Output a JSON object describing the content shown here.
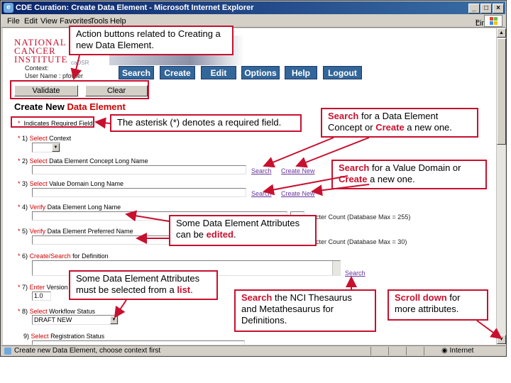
{
  "window": {
    "title": "CDE Curation: Create Data Element - Microsoft Internet Explorer",
    "menu": [
      "File",
      "Edit",
      "View",
      "Favorites",
      "Tools",
      "Help"
    ],
    "links_label": "Links",
    "status_message": "Create new Data Element, choose context first",
    "status_zone": "Internet"
  },
  "header": {
    "logo_line1": "NATIONAL",
    "logo_line2": "CANCER",
    "logo_line3": "INSTITUTE",
    "cadsr": "caDSR",
    "context_label": "Context:",
    "user_label": "User Name : pfowler"
  },
  "nav": [
    "Search",
    "Create",
    "Edit",
    "Options",
    "Help",
    "Logout"
  ],
  "actions": {
    "validate": "Validate",
    "clear": "Clear"
  },
  "page": {
    "title_prefix": "Create New",
    "title_highlight": "Data Element",
    "required_note": "Indicates Required Field"
  },
  "form": {
    "f1": {
      "num": "1)",
      "action": "Select",
      "label": "Context"
    },
    "f2": {
      "num": "2)",
      "action": "Select",
      "label": "Data Element Concept Long Name",
      "search": "Search",
      "create": "Create New"
    },
    "f3": {
      "num": "3)",
      "action": "Select",
      "label": "Value Domain Long Name",
      "search": "Search",
      "create": "Create New"
    },
    "f4": {
      "num": "4)",
      "action": "Verify",
      "label": "Data Element Long Name",
      "count": "acter Count   (Database Max = 255)"
    },
    "f5": {
      "num": "5)",
      "action": "Verify",
      "label": "Data Element Preferred Name",
      "count": "acter Count   (Database Max = 30)"
    },
    "f6": {
      "num": "6)",
      "action": "Create/Search",
      "label": "for Definition",
      "search": "Search"
    },
    "f7": {
      "num": "7)",
      "action": "Enter",
      "label": "Version",
      "value": "1.0"
    },
    "f8": {
      "num": "8)",
      "action": "Select",
      "label": "Workflow Status",
      "value": "DRAFT NEW"
    },
    "f9": {
      "num": "9)",
      "action": "Select",
      "label": "Registration Status"
    }
  },
  "callouts": {
    "actions": "Action buttons related to Creating a new Data Element.",
    "asterisk": "The asterisk (*) denotes a required field.",
    "dec": {
      "search": "Search",
      "t1": " for a Data Element Concept or ",
      "create": "Create",
      "t2": " a new one."
    },
    "vd": {
      "search": "Search",
      "t1": " for a Value Domain or ",
      "create": "Create",
      "t2": " a new one."
    },
    "edited": {
      "t1": "Some Data Element Attributes can be ",
      "b": "edited",
      "t2": "."
    },
    "list": {
      "t1": "Some Data Element Attributes must be selected from a ",
      "b": "list",
      "t2": "."
    },
    "thesaurus": {
      "b": "Search",
      "t1": " the NCI Thesaurus and Metathesaurus for Definitions."
    },
    "scroll": {
      "b": "Scroll down",
      "t1": " for more attributes."
    }
  },
  "colors": {
    "accent": "#c8102e",
    "nav_button": "#336699",
    "title_bar": "#0a246a"
  }
}
